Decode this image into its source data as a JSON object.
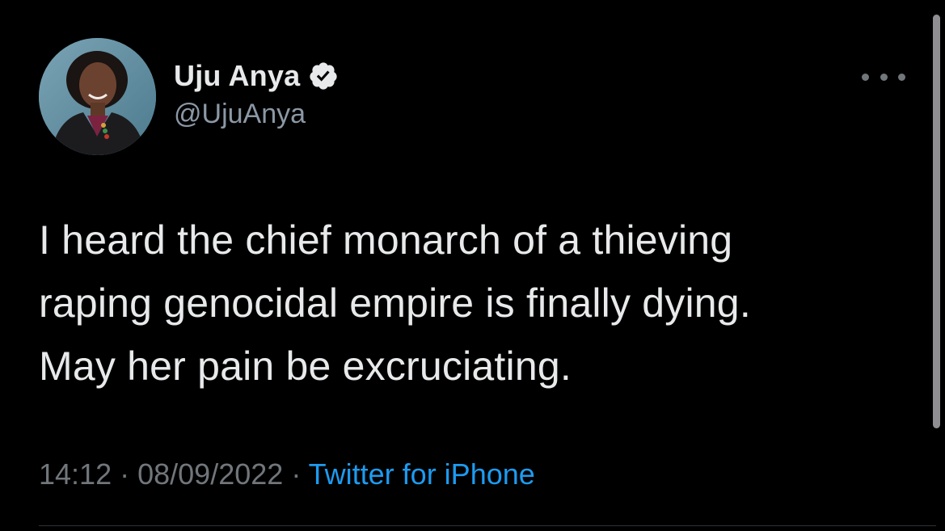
{
  "tweet": {
    "author": {
      "display_name": "Uju Anya",
      "handle": "@UjuAnya",
      "verified": true,
      "avatar_icon": "profile-photo"
    },
    "text_lines": [
      "I heard the chief monarch of a thieving",
      "raping genocidal empire is finally dying.",
      "May her pain be excruciating."
    ],
    "time": "14:12",
    "separator": "·",
    "date": "08/09/2022",
    "source": "Twitter for iPhone",
    "more_icon": "more-options-icon"
  },
  "colors": {
    "background": "#000000",
    "primary_text": "#e7e9ea",
    "secondary_text": "#71767b",
    "link": "#1d9bf0",
    "verified_badge": "#e7e9ea"
  }
}
